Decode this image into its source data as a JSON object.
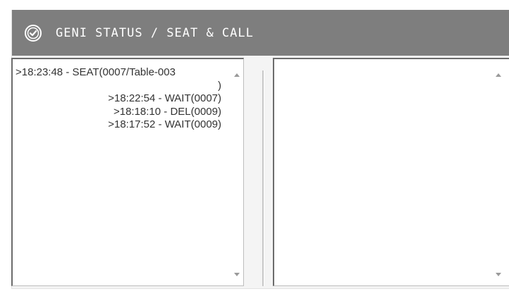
{
  "header": {
    "title": "GENI STATUS / SEAT & CALL",
    "icon": "check-circle-icon",
    "background": "#7e7e7e",
    "text_color": "#ffffff"
  },
  "left_list": {
    "entries": [
      {
        "text": ">18:23:48 - SEAT(0007/Table-003"
      },
      {
        "text": ")"
      },
      {
        "text": ">18:22:54 - WAIT(0007)"
      },
      {
        "text": ">18:18:10 - DEL(0009)"
      },
      {
        "text": ">18:17:52 - WAIT(0009)"
      }
    ],
    "scroll_up_icon": "arrow-up-icon",
    "scroll_down_icon": "arrow-down-icon"
  },
  "right_list": {
    "entries": [],
    "scroll_up_icon": "arrow-up-icon",
    "scroll_down_icon": "arrow-down-icon"
  }
}
